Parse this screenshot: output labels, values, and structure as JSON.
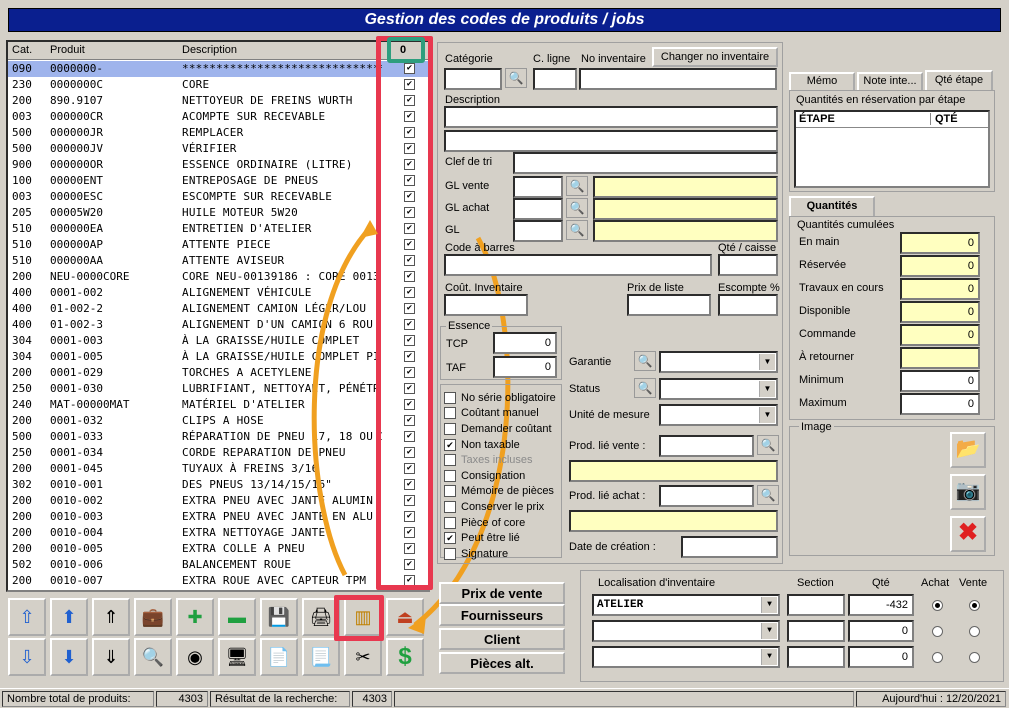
{
  "window": {
    "title": "Gestion des codes de produits / jobs"
  },
  "list": {
    "headers": {
      "cat": "Cat.",
      "produit": "Produit",
      "description": "Description",
      "count": "0"
    },
    "rows": [
      {
        "cat": "090",
        "produit": "0000000-",
        "desc": "******************************",
        "checked": true,
        "selected": true
      },
      {
        "cat": "230",
        "produit": "0000000C",
        "desc": "CORE",
        "checked": true
      },
      {
        "cat": "200",
        "produit": "890.9107",
        "desc": "NETTOYEUR DE FREINS WURTH",
        "checked": true
      },
      {
        "cat": "003",
        "produit": "000000CR",
        "desc": "ACOMPTE SUR RECEVABLE",
        "checked": true
      },
      {
        "cat": "500",
        "produit": "000000JR",
        "desc": "REMPLACER",
        "checked": true
      },
      {
        "cat": "500",
        "produit": "000000JV",
        "desc": "VÉRIFIER",
        "checked": true
      },
      {
        "cat": "900",
        "produit": "000000OR",
        "desc": "ESSENCE ORDINAIRE (LITRE)",
        "checked": true
      },
      {
        "cat": "100",
        "produit": "00000ENT",
        "desc": "ENTREPOSAGE DE PNEUS",
        "checked": true
      },
      {
        "cat": "003",
        "produit": "00000ESC",
        "desc": "ESCOMPTE SUR RECEVABLE",
        "checked": true
      },
      {
        "cat": "205",
        "produit": "00005W20",
        "desc": "HUILE MOTEUR 5W20",
        "checked": true
      },
      {
        "cat": "510",
        "produit": "000000EA",
        "desc": "ENTRETIEN D'ATELIER",
        "checked": true
      },
      {
        "cat": "510",
        "produit": "000000AP",
        "desc": "ATTENTE PIECE",
        "checked": true
      },
      {
        "cat": "510",
        "produit": "000000AA",
        "desc": "ATTENTE AVISEUR",
        "checked": true
      },
      {
        "cat": "200",
        "produit": "NEU-0000CORE",
        "desc": "CORE NEU-00139186 : CORE 0013",
        "checked": true
      },
      {
        "cat": "400",
        "produit": "0001-002",
        "desc": "ALIGNEMENT VÉHICULE",
        "checked": true
      },
      {
        "cat": "400",
        "produit": "01-002-2",
        "desc": "ALIGNEMENT CAMION LÉGER/LOU",
        "checked": true
      },
      {
        "cat": "400",
        "produit": "01-002-3",
        "desc": "ALIGNEMENT D'UN CAMION 6 ROU",
        "checked": true
      },
      {
        "cat": "304",
        "produit": "0001-003",
        "desc": "À LA GRAISSE/HUILE COMPLET",
        "checked": true
      },
      {
        "cat": "304",
        "produit": "0001-005",
        "desc": "À LA GRAISSE/HUILE COMPLET PI",
        "checked": true
      },
      {
        "cat": "200",
        "produit": "0001-029",
        "desc": "TORCHES A ACETYLENE",
        "checked": true
      },
      {
        "cat": "250",
        "produit": "0001-030",
        "desc": "LUBRIFIANT, NETTOYANT, PÉNÉTR",
        "checked": true
      },
      {
        "cat": "240",
        "produit": "MAT-00000MAT",
        "desc": "MATÉRIEL D'ATELIER",
        "checked": true
      },
      {
        "cat": "200",
        "produit": "0001-032",
        "desc": "CLIPS A HOSE",
        "checked": true
      },
      {
        "cat": "500",
        "produit": "0001-033",
        "desc": "RÉPARATION DE PNEU 17, 18 OU 1",
        "checked": true
      },
      {
        "cat": "250",
        "produit": "0001-034",
        "desc": "CORDE REPARATION DE PNEU",
        "checked": true
      },
      {
        "cat": "200",
        "produit": "0001-045",
        "desc": "TUYAUX À FREINS 3/16",
        "checked": true
      },
      {
        "cat": "302",
        "produit": "0010-001",
        "desc": "DES PNEUS 13/14/15/16\"",
        "checked": true
      },
      {
        "cat": "200",
        "produit": "0010-002",
        "desc": "EXTRA PNEU AVEC JANTE ALUMIN",
        "checked": true
      },
      {
        "cat": "200",
        "produit": "0010-003",
        "desc": "EXTRA PNEU AVEC JANTE EN ALU",
        "checked": true
      },
      {
        "cat": "200",
        "produit": "0010-004",
        "desc": "EXTRA NETTOYAGE JANTE",
        "checked": true
      },
      {
        "cat": "200",
        "produit": "0010-005",
        "desc": "EXTRA COLLE A PNEU",
        "checked": true
      },
      {
        "cat": "502",
        "produit": "0010-006",
        "desc": "BALANCEMENT ROUE",
        "checked": true
      },
      {
        "cat": "200",
        "produit": "0010-007",
        "desc": "EXTRA ROUE AVEC CAPTEUR TPM",
        "checked": true
      }
    ]
  },
  "form": {
    "categorie": "Catégorie",
    "c_ligne": "C. ligne",
    "no_inventaire": "No inventaire",
    "changer_btn": "Changer no inventaire",
    "description": "Description",
    "clef_de_tri": "Clef de tri",
    "gl_vente": "GL vente",
    "gl_achat": "GL achat",
    "gl_other": "GL",
    "code_barres": "Code à barres",
    "qte_caisse": "Qté / caisse",
    "cout_inventaire": "Coût. Inventaire",
    "prix_de_liste": "Prix de liste",
    "escompte": "Escompte %",
    "essence": "Essence",
    "tcp": "TCP",
    "tcp_val": "0",
    "taf": "TAF",
    "taf_val": "0",
    "garantie": "Garantie",
    "status": "Status",
    "unite": "Unité de mesure",
    "prod_lie_vente": "Prod. lié vente :",
    "prod_lie_achat": "Prod. lié achat :",
    "date_creation": "Date de création :"
  },
  "options": [
    {
      "label": "No série obligatoire",
      "checked": false,
      "disabled": false
    },
    {
      "label": "Coûtant manuel",
      "checked": false,
      "disabled": false
    },
    {
      "label": "Demander coûtant",
      "checked": false,
      "disabled": false
    },
    {
      "label": "Non taxable",
      "checked": true,
      "disabled": false
    },
    {
      "label": "Taxes incluses",
      "checked": false,
      "disabled": true
    },
    {
      "label": "Consignation",
      "checked": false,
      "disabled": false
    },
    {
      "label": "Mémoire de pièces",
      "checked": false,
      "disabled": false
    },
    {
      "label": "Conserver le prix",
      "checked": false,
      "disabled": false
    },
    {
      "label": "Pièce of core",
      "checked": false,
      "disabled": false
    },
    {
      "label": "Peut être lié",
      "checked": true,
      "disabled": false
    },
    {
      "label": "Signature",
      "checked": false,
      "disabled": false
    }
  ],
  "right_tabs": [
    "Mémo",
    "Note inte...",
    "Qté étape"
  ],
  "reservation": {
    "title": "Quantités en réservation par étape",
    "col1": "ÉTAPE",
    "col2": "QTÉ"
  },
  "quantites_tab": "Quantités",
  "quantites": {
    "title": "Quantités cumulées",
    "rows": [
      {
        "label": "En main",
        "value": "0",
        "yellow": true
      },
      {
        "label": "Réservée",
        "value": "0",
        "yellow": true
      },
      {
        "label": "Travaux en cours",
        "value": "0",
        "yellow": true
      },
      {
        "label": "Disponible",
        "value": "0",
        "yellow": true
      },
      {
        "label": "Commande",
        "value": "0",
        "yellow": true
      },
      {
        "label": "À retourner",
        "value": "",
        "yellow": true
      },
      {
        "label": "Minimum",
        "value": "0",
        "yellow": false
      },
      {
        "label": "Maximum",
        "value": "0",
        "yellow": false
      }
    ]
  },
  "image_label": "Image",
  "big_buttons": [
    "Prix de vente",
    "Fournisseurs",
    "Client",
    "Pièces alt."
  ],
  "inventory": {
    "headers": {
      "loc": "Localisation d'inventaire",
      "section": "Section",
      "qte": "Qté",
      "achat": "Achat",
      "vente": "Vente"
    },
    "rows": [
      {
        "loc": "ATELIER",
        "section": "",
        "qte": "-432",
        "achat": true,
        "vente": true
      },
      {
        "loc": "",
        "section": "",
        "qte": "0",
        "achat": false,
        "vente": false
      },
      {
        "loc": "",
        "section": "",
        "qte": "0",
        "achat": false,
        "vente": false
      }
    ]
  },
  "status": {
    "total_label": "Nombre total de produits:",
    "total_value": "4303",
    "result_label": "Résultat de la recherche:",
    "result_value": "4303",
    "today": "Aujourd'hui : 12/20/2021"
  },
  "colors": {
    "title_bg": "#0a1f8f",
    "selected_row": "#9fb4ec",
    "highlight_red": "#e8384f",
    "highlight_green": "#2e9e7e",
    "arrow_orange": "#f0a020",
    "yellow_field": "#ffffc0"
  },
  "toolbar_icons": [
    "up-arrow-page-icon",
    "up-arrow-circle-icon",
    "up-arrow-icon",
    "briefcase-icon",
    "plus-icon",
    "minus-icon",
    "floppy-disk-icon",
    "printer-icon",
    "barcode-icon",
    "exit-icon",
    "down-arrow-page-icon",
    "down-arrow-circle-icon",
    "down-arrow-icon",
    "magnifier-icon",
    "search-eye-icon",
    "computer-icon",
    "document-icon",
    "paper-icon",
    "tape-icon",
    "dollar-icon"
  ]
}
